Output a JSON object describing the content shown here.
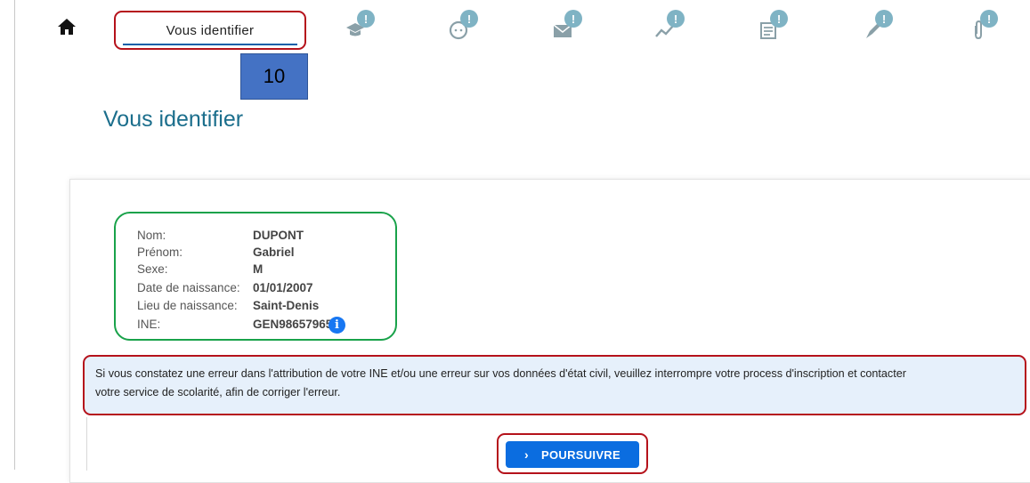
{
  "nav": {
    "active_tab": "Vous identifier",
    "badge_text": "!",
    "icons": [
      "home-icon",
      "graduation-cap-icon",
      "face-icon",
      "envelope-icon",
      "chart-line-icon",
      "document-list-icon",
      "pen-icon",
      "paperclip-icon"
    ]
  },
  "annotation": {
    "step": "10"
  },
  "page": {
    "title": "Vous identifier"
  },
  "identity": {
    "rows": [
      {
        "label": "Nom:",
        "value": "DUPONT"
      },
      {
        "label": "Prénom:",
        "value": "Gabriel"
      },
      {
        "label": "Sexe:",
        "value": "M"
      },
      {
        "label": "Date de naissance:",
        "value": "01/01/2007"
      },
      {
        "label": "Lieu de naissance:",
        "value": "Saint-Denis"
      },
      {
        "label": "INE:",
        "value": "GEN98657965"
      }
    ],
    "info_glyph": "i"
  },
  "alert": {
    "line1": "Si vous constatez une erreur dans l'attribution de votre INE et/ou une erreur sur vos données d'état civil, veuillez interrompre votre process d'inscription et contacter",
    "line2": "votre service de scolarité, afin de corriger l'erreur."
  },
  "actions": {
    "continue_label": "POURSUIVRE",
    "chevron": "›"
  },
  "colors": {
    "accent_blue": "#0b6de0",
    "title": "#1b6e8c",
    "badge": "#7fb3c4",
    "highlight_red": "#b5121b",
    "highlight_green": "#19a24a"
  }
}
